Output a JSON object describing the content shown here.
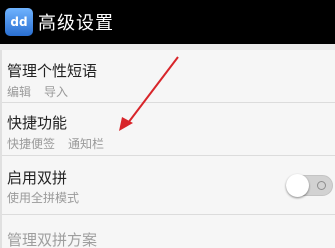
{
  "titlebar": {
    "icon": "dict-app-icon",
    "icon_glyph": "dd",
    "title": "高级设置"
  },
  "settings": {
    "manage_phrases": {
      "title": "管理个性短语",
      "actions": [
        "编辑",
        "导入"
      ]
    },
    "shortcuts": {
      "title": "快捷功能",
      "actions": [
        "快捷便签",
        "通知栏"
      ]
    },
    "double_pinyin": {
      "title": "启用双拼",
      "subtitle": "使用全拼模式",
      "enabled": false
    },
    "manage_double_pinyin": {
      "title": "管理双拼方案"
    }
  },
  "annotation": {
    "color": "#d8252a"
  }
}
